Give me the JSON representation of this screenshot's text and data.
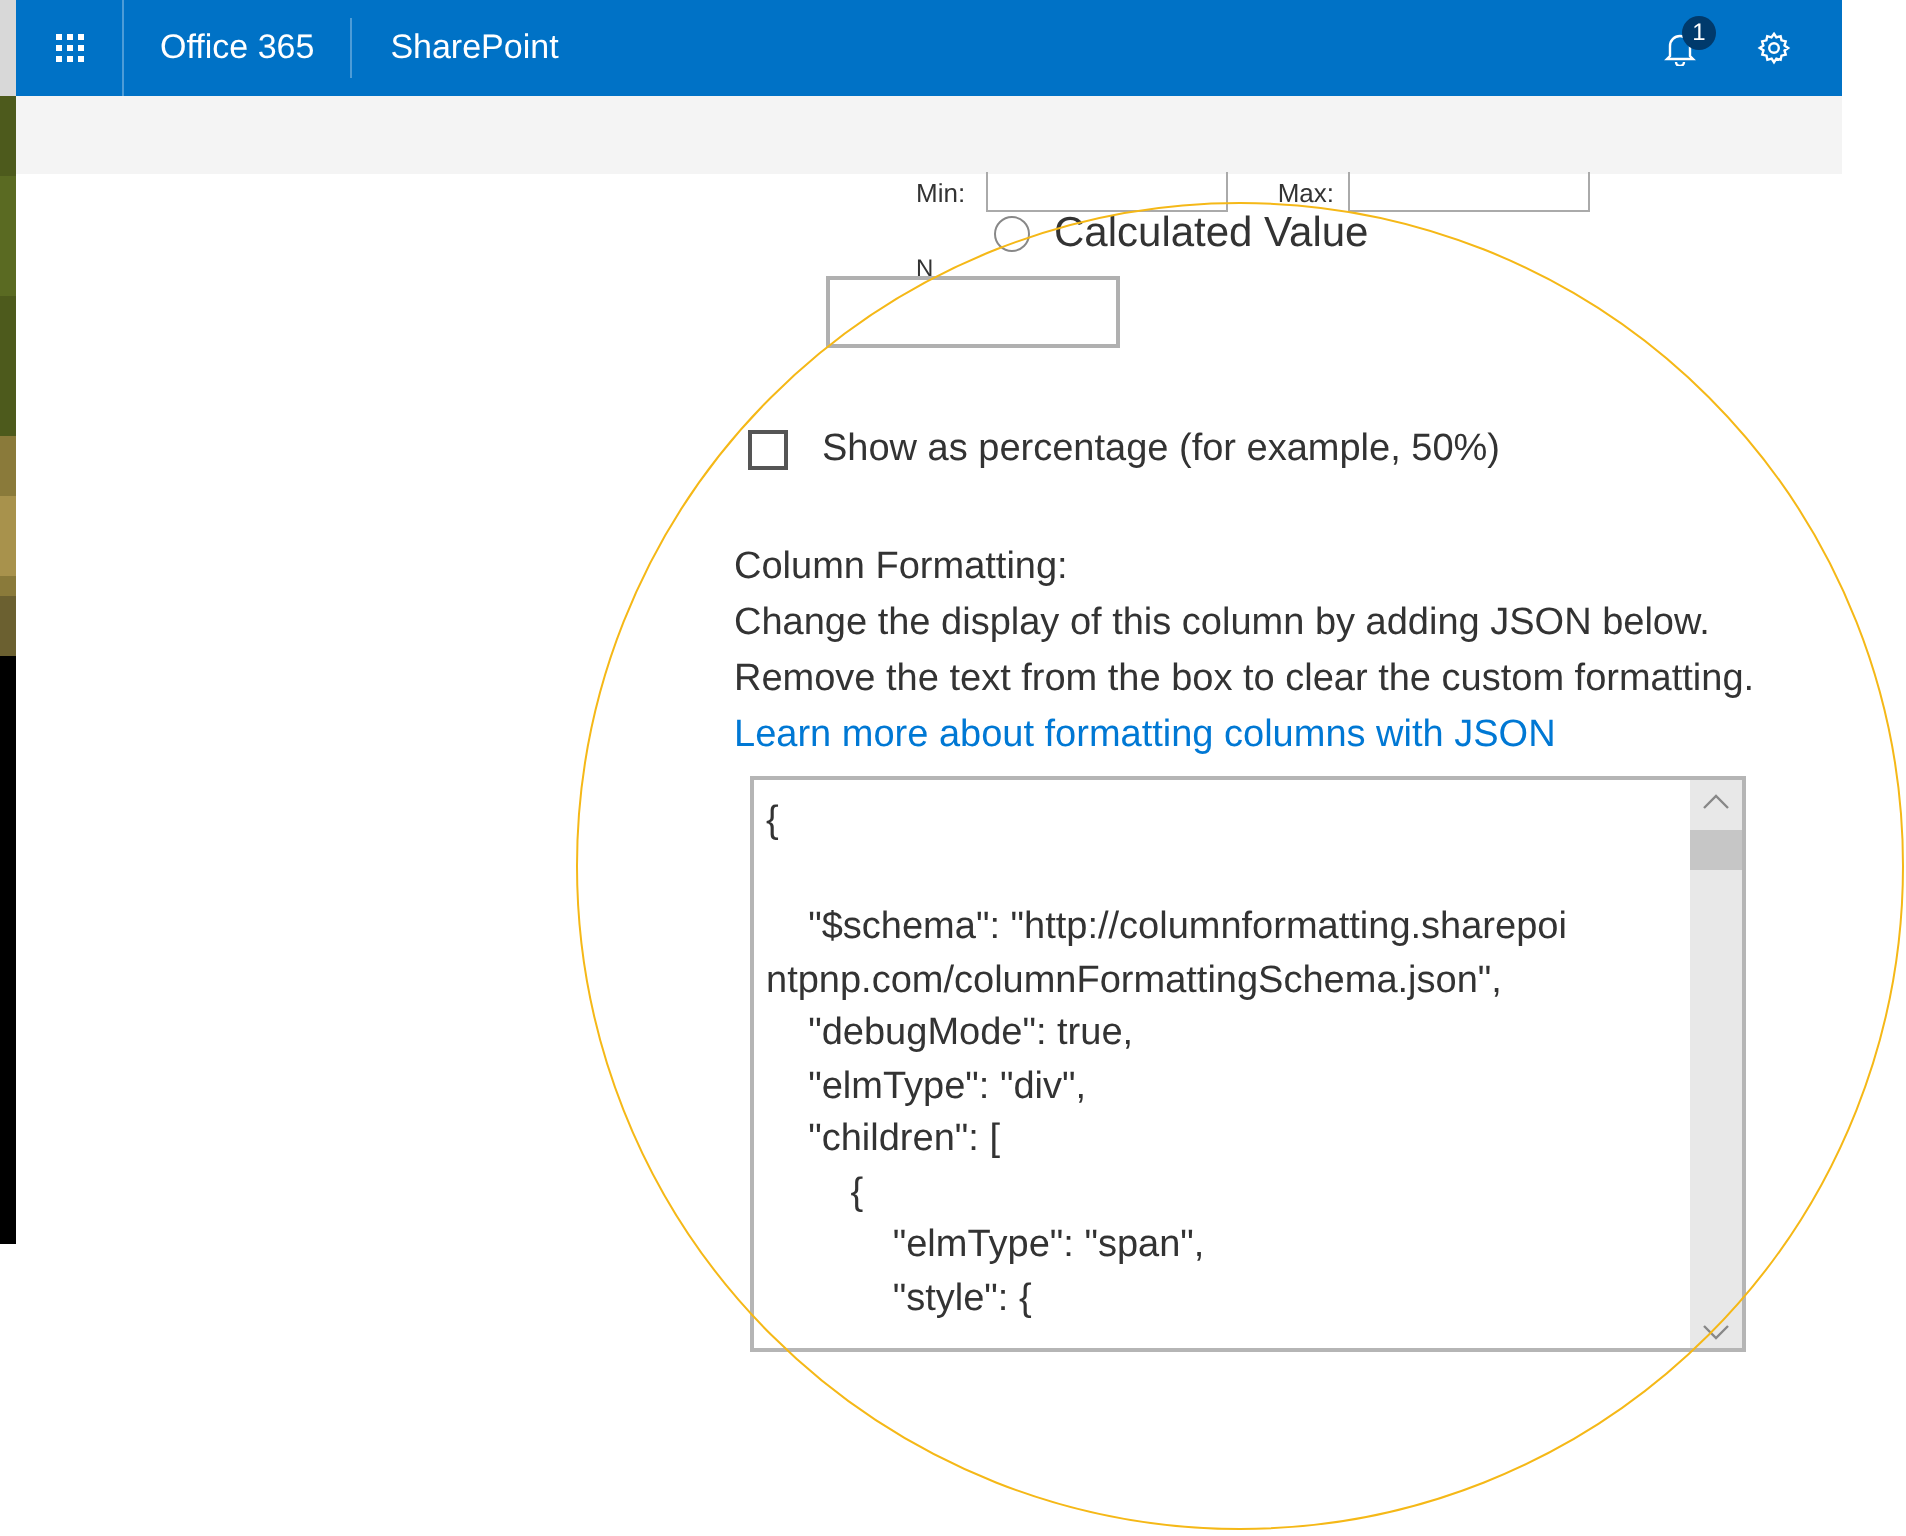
{
  "top_bar": {
    "app_name": "Office 365",
    "site_name": "SharePoint",
    "notification_count": "1"
  },
  "range": {
    "min_label": "Min:",
    "max_label": "Max:"
  },
  "calculated_option": {
    "label": "Calculated Value",
    "selected": false
  },
  "number_label": "N",
  "percentage_option": {
    "label": "Show as percentage (for example, 50%)",
    "checked": false
  },
  "column_formatting": {
    "heading": "Column Formatting:",
    "lines": [
      "Change the display of this column by adding JSON below.",
      "Remove the text from the box to clear the custom formatting."
    ],
    "link": "Learn more about formatting columns with JSON",
    "code_lines": [
      {
        "text": "{"
      },
      {
        "text": "    \"$schema\": \"http://columnformatting.sharepoi",
        "blank_line_before": true
      },
      {
        "text": "ntpnp.com/columnFormattingSchema.json\","
      },
      {
        "text": "    \"debugMode\": true,"
      },
      {
        "text": "    \"elmType\": \"div\","
      },
      {
        "text": "    \"children\": ["
      },
      {
        "text": "        {"
      },
      {
        "text": "            \"elmType\": \"span\","
      },
      {
        "text": "            \"style\": {"
      }
    ]
  }
}
